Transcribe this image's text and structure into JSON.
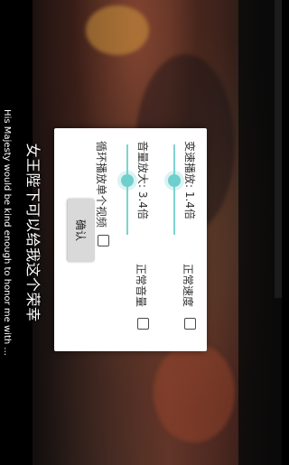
{
  "subtitles": {
    "chinese": "女王陛下可以给我这个荣幸",
    "english": "His Majesty would be kind enough to honor me with ..."
  },
  "dialog": {
    "speed": {
      "label": "变速播放: 1.4倍",
      "value_fraction": 0.4,
      "reset_label": "正常速度"
    },
    "volume": {
      "label": "音量放大: 3.4倍",
      "value_fraction": 0.4,
      "reset_label": "正常音量"
    },
    "loop": {
      "label": "循环播放单个视频"
    },
    "confirm_label": "确认"
  },
  "colors": {
    "accent": "#6fcfcc",
    "dialog_bg": "#ffffff",
    "button_bg": "#d9d9d9"
  }
}
